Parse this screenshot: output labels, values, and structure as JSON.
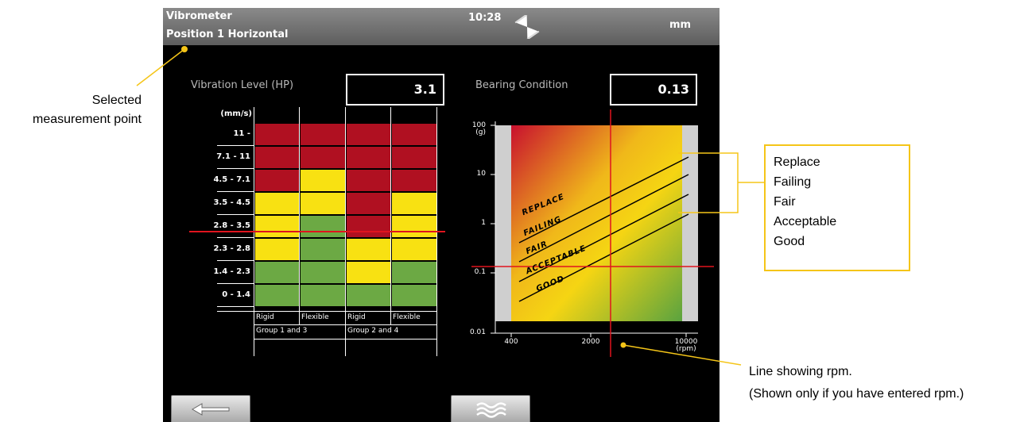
{
  "titlebar": {
    "app_name": "Vibrometer",
    "position": "Position 1 Horizontal",
    "time": "10:28",
    "unit": "mm"
  },
  "vibration": {
    "label": "Vibration Level (HP)",
    "value": "3.1",
    "unit_label": "(mm/s)",
    "rows": [
      "11 -",
      "7.1 - 11",
      "4.5 - 7.1",
      "3.5 - 4.5",
      "2.8 - 3.5",
      "2.3 - 2.8",
      "1.4 - 2.3",
      "0 - 1.4"
    ],
    "columns": [
      "Rigid",
      "Flexible",
      "Rigid",
      "Flexible"
    ],
    "groups": [
      "Group 1 and 3",
      "Group 2 and 4"
    ],
    "grid": [
      [
        "red",
        "red",
        "red",
        "red"
      ],
      [
        "red",
        "red",
        "red",
        "red"
      ],
      [
        "red",
        "yellow",
        "red",
        "red"
      ],
      [
        "yellow",
        "yellow",
        "red",
        "yellow"
      ],
      [
        "yellow",
        "green",
        "red",
        "yellow"
      ],
      [
        "yellow",
        "green",
        "yellow",
        "yellow"
      ],
      [
        "green",
        "green",
        "yellow",
        "green"
      ],
      [
        "green",
        "green",
        "green",
        "green"
      ]
    ],
    "indicator_row": "2.8 - 3.5"
  },
  "bearing": {
    "label": "Bearing Condition",
    "value": "0.13",
    "y_ticks": [
      "100\n(g)",
      "10",
      "1",
      "0.1",
      "0.01"
    ],
    "x_ticks": [
      "400",
      "2000",
      "10000\n(rpm)"
    ],
    "zones": [
      "REPLACE",
      "FAILING",
      "FAIR",
      "ACCEPTABLE",
      "GOOD"
    ],
    "current_value_g": 0.13
  },
  "annotations": {
    "selected_point": "Selected\nmeasurement point",
    "legend": [
      "Replace",
      "Failing",
      "Fair",
      "Acceptable",
      "Good"
    ],
    "rpm_line_1": "Line showing rpm.",
    "rpm_line_2": "(Shown only if you have entered rpm.)"
  },
  "colors": {
    "red": "#b01021",
    "yellow": "#f8e112",
    "green": "#6ca944",
    "callout": "#f5c518",
    "indicator": "#e0141e"
  },
  "icons": {
    "back_button": "arrow-left-icon",
    "menu_button": "wave-lines-icon",
    "status": "hourglass-icon"
  }
}
